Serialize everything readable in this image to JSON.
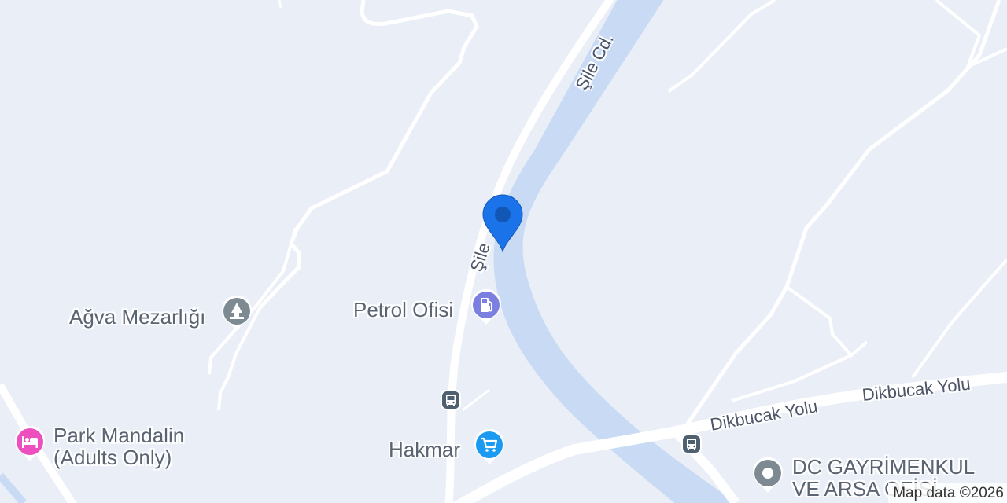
{
  "map": {
    "colors": {
      "land": "#e9eef7",
      "water": "#c8daf4",
      "road": "#ffffff",
      "location_pin": "#1a73e8"
    },
    "roads": [
      {
        "label": "Şile Cd."
      },
      {
        "label": "Şile"
      },
      {
        "label": "Dikbucak Yolu"
      },
      {
        "label": "Dikbucak Yolu"
      }
    ],
    "pois": [
      {
        "label": "Ağva Mezarlığı",
        "icon": "cemetery-icon",
        "color": "#7d8a92"
      },
      {
        "label": "Petrol Ofisi",
        "icon": "gas-station-icon",
        "color": "#7b7fe0"
      },
      {
        "label": "Hakmar",
        "icon": "shopping-cart-icon",
        "color": "#1a9af0"
      },
      {
        "label": "Park Mandalin\n(Adults Only)",
        "line1": "Park Mandalin",
        "line2": "(Adults Only)",
        "icon": "hotel-icon",
        "color": "#ee4fbe"
      },
      {
        "label": "DC GAYRİMENKUL VE ARSA OFİSİ",
        "line1": "DC GAYRİMENKUL",
        "line2": "VE ARSA OFİSİ",
        "icon": "place-icon",
        "color": "#7d8a92"
      }
    ],
    "transit": [
      {
        "icon": "bus-stop-icon"
      },
      {
        "icon": "bus-stop-icon"
      }
    ],
    "attribution": "Map data ©2026"
  }
}
